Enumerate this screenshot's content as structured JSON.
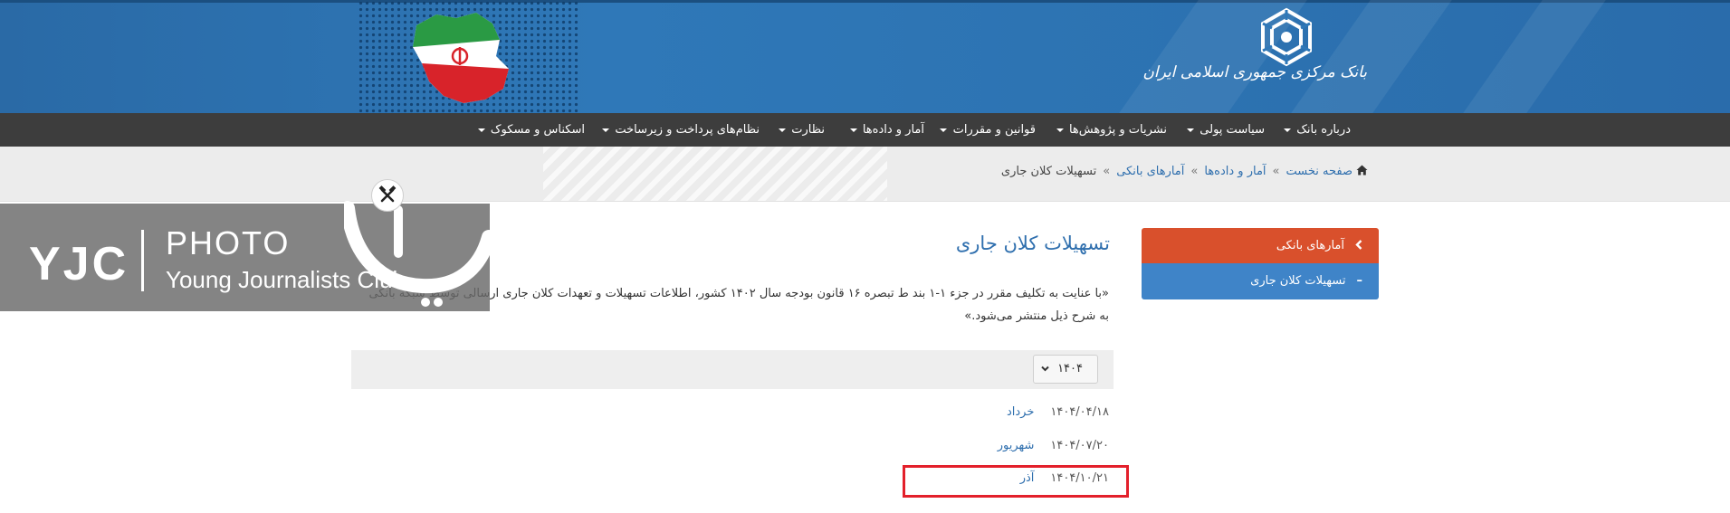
{
  "header": {
    "bank_name": "بانک مرکزی جمهوری اسلامی ایران",
    "emblem_icon": "central-bank-emblem-icon",
    "flag_icon": "iran-flag-map-icon",
    "colors": {
      "banner": "#2f78b8",
      "nav": "#3d3d3d"
    }
  },
  "nav": {
    "items": [
      {
        "label": "درباره بانک",
        "dropdown": true
      },
      {
        "label": "سیاست پولی",
        "dropdown": true
      },
      {
        "label": "نشریات و پژوهش‌ها",
        "dropdown": true
      },
      {
        "label": "قوانین و مقررات",
        "dropdown": true
      },
      {
        "label": "آمار و داده‌ها",
        "dropdown": true
      },
      {
        "label": "نظارت",
        "dropdown": true
      },
      {
        "label": "نظام‌های پرداخت و زیرساخت",
        "dropdown": true
      },
      {
        "label": "اسکناس و مسکوک",
        "dropdown": true
      }
    ]
  },
  "breadcrumb": {
    "home_icon": "home-icon",
    "items": [
      "صفحه نخست",
      "آمار و داده‌ها",
      "آمارهای بانکی"
    ],
    "separator": "»",
    "current": "تسهیلات کلان جاری"
  },
  "sidebar": {
    "parent_label": "آمارهای بانکی",
    "parent_icon": "chevron-left-icon",
    "child_label": "تسهیلات کلان جاری",
    "child_prefix": "–",
    "colors": {
      "parent": "#d9502c",
      "child": "#3f84c8"
    }
  },
  "main": {
    "title": "تسهیلات کلان جاری",
    "description": "«با عنایت به تکلیف مقرر در جزء ۱-۱ بند ط تبصره ۱۶ قانون بودجه سال ۱۴۰۲ کشور، اطلاعات تسهیلات و تعهدات کلان جاری ارسالی توسط شبکه بانکی به شرح ذیل منتشر می‌شود.»",
    "year_select": {
      "value": "۱۴۰۴",
      "icon": "chevron-down-icon"
    },
    "entries": [
      {
        "month": "خرداد",
        "date": "۱۴۰۴/۰۴/۱۸"
      },
      {
        "month": "شهریور",
        "date": "۱۴۰۴/۰۷/۲۰"
      },
      {
        "month": "آذر",
        "date": "۱۴۰۴/۱۰/۲۱"
      }
    ],
    "highlight_color": "#e3202b"
  },
  "watermark": {
    "brand": "YJC",
    "photo": "PHOTO",
    "club": "Young Journalists Club",
    "icon": "yjc-logo-icon"
  },
  "tools_icon": "tools-icon"
}
